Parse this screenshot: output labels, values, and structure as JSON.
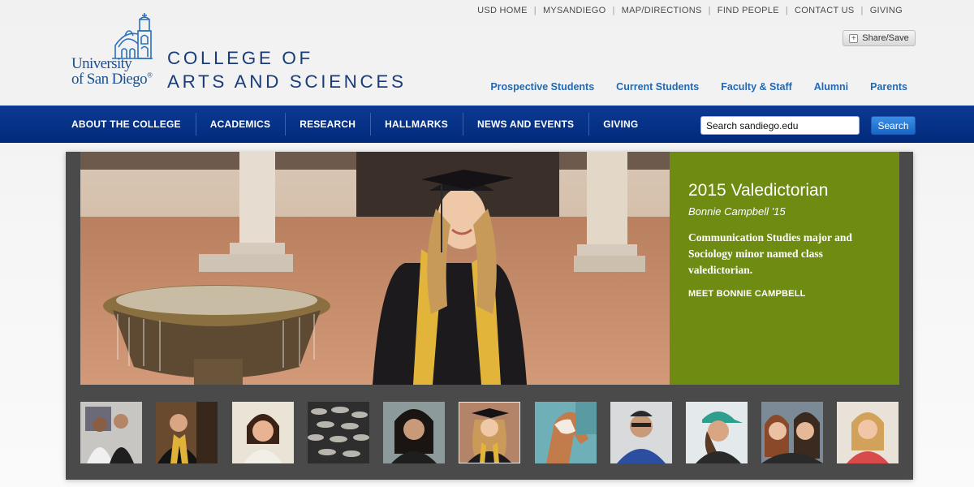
{
  "utility_nav": [
    "USD HOME",
    "MYSANDIEGO",
    "MAP/DIRECTIONS",
    "FIND PEOPLE",
    "CONTACT US",
    "GIVING"
  ],
  "share_label": "Share/Save",
  "logo": {
    "line1": "University",
    "line2": "of San Diego",
    "mark": "®",
    "icon": "mission-tower-icon"
  },
  "college": {
    "line1": "COLLEGE OF",
    "line2": "ARTS AND SCIENCES"
  },
  "audience_nav": [
    "Prospective Students",
    "Current Students",
    "Faculty & Staff",
    "Alumni",
    "Parents"
  ],
  "main_nav": [
    "ABOUT THE COLLEGE",
    "ACADEMICS",
    "RESEARCH",
    "HALLMARKS",
    "NEWS AND EVENTS",
    "GIVING"
  ],
  "search": {
    "value": "Search sandiego.edu",
    "button_label": "Search"
  },
  "hero": {
    "title": "2015 Valedictorian",
    "subtitle": "Bonnie Campbell '15",
    "description": "Communication Studies major and Sociology minor named class valedictorian.",
    "link": "MEET BONNIE CAMPBELL"
  },
  "colors": {
    "nav_blue": "#012a7c",
    "panel_green": "#6f8c12",
    "link_blue": "#2468b1",
    "frame_gray": "#4a4a4a"
  },
  "thumbnails": [
    {
      "name": "thumb-two-women",
      "active": false
    },
    {
      "name": "thumb-graduate-man",
      "active": false
    },
    {
      "name": "thumb-smiling-woman",
      "active": false
    },
    {
      "name": "thumb-fish-pile",
      "active": false
    },
    {
      "name": "thumb-woman-portrait",
      "active": false
    },
    {
      "name": "thumb-valedictorian",
      "active": true
    },
    {
      "name": "thumb-horse",
      "active": false
    },
    {
      "name": "thumb-man-glasses",
      "active": false
    },
    {
      "name": "thumb-woman-cap",
      "active": false
    },
    {
      "name": "thumb-two-girls",
      "active": false
    },
    {
      "name": "thumb-young-woman",
      "active": false
    }
  ]
}
